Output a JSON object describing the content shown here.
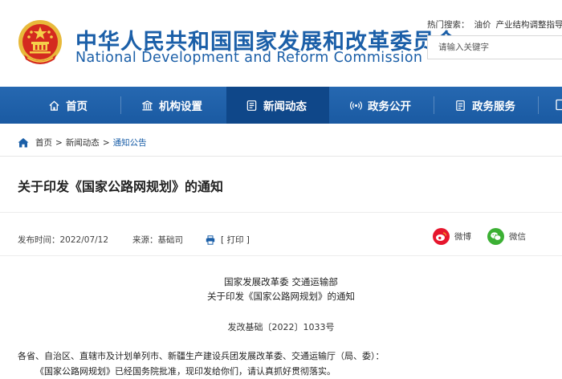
{
  "site": {
    "title_cn": "中华人民共和国国家发展和改革委员会",
    "title_en": "National Development and Reform Commission",
    "emblem": "national-emblem"
  },
  "hot_search": {
    "label": "热门搜索：",
    "items": [
      "油价",
      "产业结构调整指导"
    ]
  },
  "search": {
    "placeholder": "请输入关键字"
  },
  "nav": {
    "items": [
      {
        "label": "首页",
        "icon": "home-icon"
      },
      {
        "label": "机构设置",
        "icon": "institution-icon"
      },
      {
        "label": "新闻动态",
        "icon": "news-icon"
      },
      {
        "label": "政务公开",
        "icon": "signal-icon"
      },
      {
        "label": "政务服务",
        "icon": "document-icon"
      }
    ],
    "active_index": 2,
    "colors": {
      "bar": "#1a5aa2",
      "active": "#0f4789"
    }
  },
  "breadcrumb": {
    "home": "首页",
    "section": "新闻动态",
    "current": "通知公告",
    "separator": ">"
  },
  "article": {
    "title": "关于印发《国家公路网规划》的通知",
    "date_label": "发布时间：2022/07/12",
    "source_label": "来源：基础司",
    "print_label": "[ 打印 ]",
    "share": [
      {
        "label": "微博",
        "icon": "weibo-icon",
        "color": "#e6162d"
      },
      {
        "label": "微信",
        "icon": "wechat-icon",
        "color": "#3cb034"
      }
    ],
    "issuers": "国家发展改革委 交通运输部",
    "subtitle": "关于印发《国家公路网规划》的通知",
    "doc_number": "发改基础〔2022〕1033号",
    "recipients": "各省、自治区、直辖市及计划单列市、新疆生产建设兵团发展改革委、交通运输厅（局、委）：",
    "first_paragraph": "《国家公路网规划》已经国务院批准，现印发给你们，请认真抓好贯彻落实。"
  }
}
